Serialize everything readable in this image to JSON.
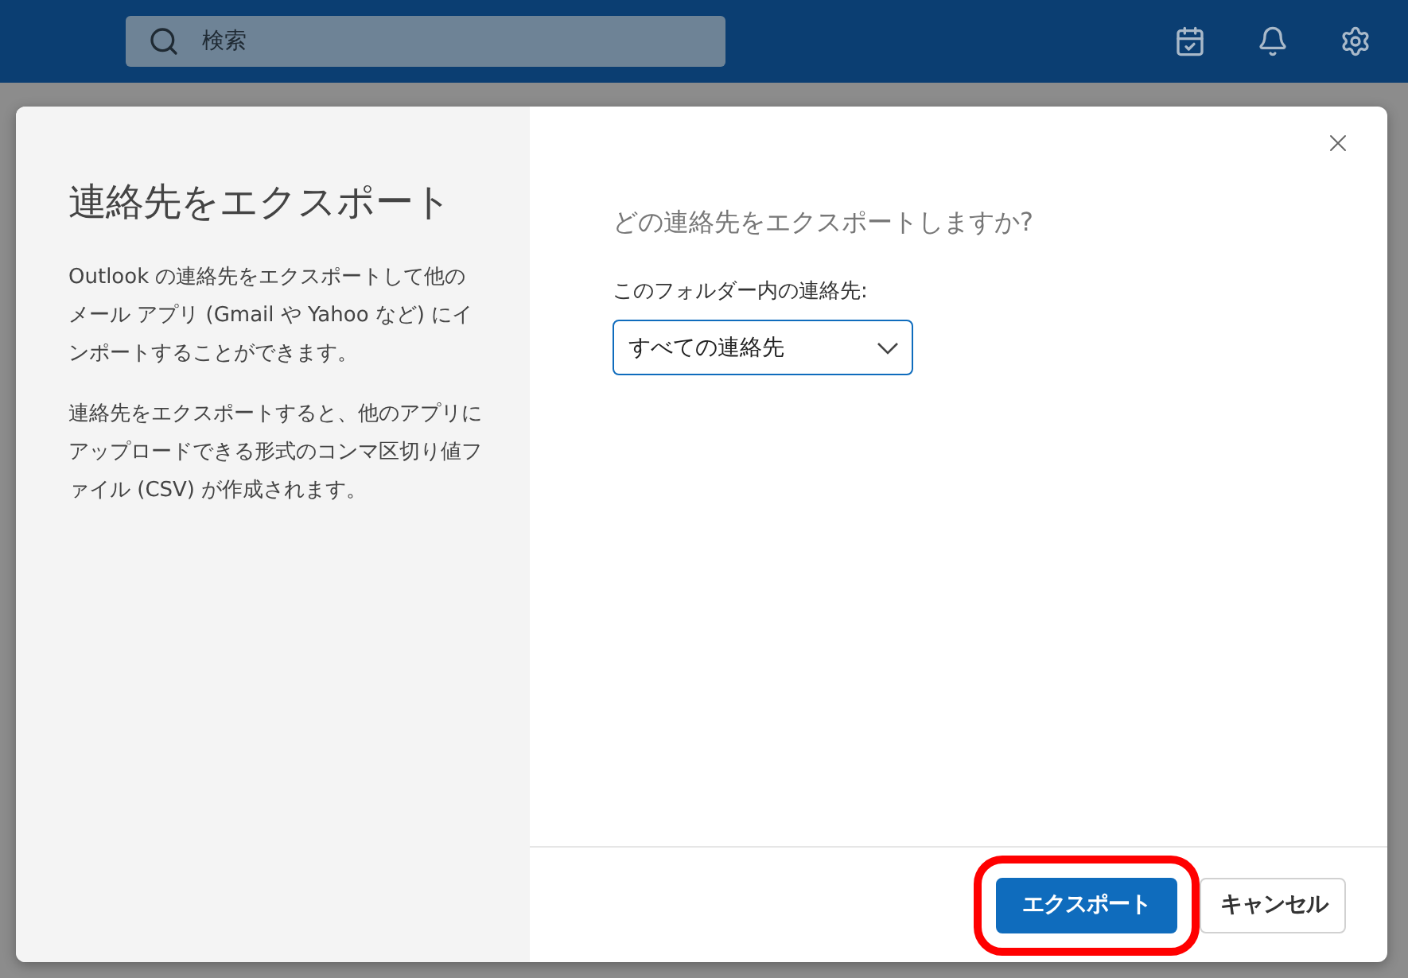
{
  "top_bar": {
    "search": {
      "placeholder": "検索"
    }
  },
  "dialog": {
    "title": "連絡先をエクスポート",
    "paragraphs": [
      "Outlook の連絡先をエクスポートして他のメール アプリ (Gmail や Yahoo など) にインポートすることができます。",
      "連絡先をエクスポートすると、他のアプリにアップロードできる形式のコンマ区切り値ファイル (CSV) が作成されます。"
    ],
    "question": "どの連絡先をエクスポートしますか?",
    "folder_label": "このフォルダー内の連絡先:",
    "folder_select": {
      "value": "すべての連絡先"
    },
    "buttons": [
      {
        "label": "エクスポート",
        "kind": "primary",
        "highlighted": true
      },
      {
        "label": "キャンセル",
        "kind": "secondary",
        "highlighted": false
      }
    ]
  }
}
